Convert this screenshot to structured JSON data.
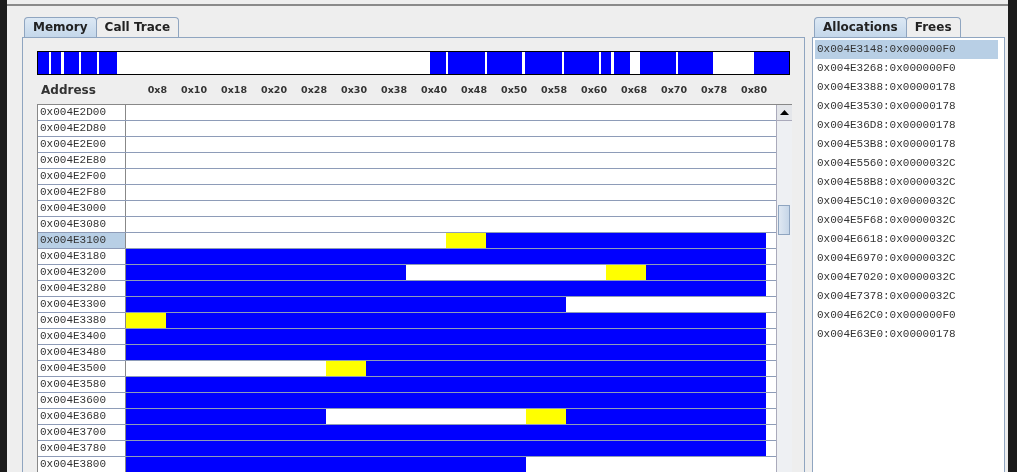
{
  "tabs": [
    {
      "label": "Memory",
      "selected": true
    },
    {
      "label": "Call Trace",
      "selected": false
    }
  ],
  "memory": {
    "address_header": "Address",
    "columns": [
      "0x8",
      "0x10",
      "0x18",
      "0x20",
      "0x28",
      "0x30",
      "0x38",
      "0x40",
      "0x48",
      "0x50",
      "0x58",
      "0x60",
      "0x68",
      "0x70",
      "0x78",
      "0x80"
    ],
    "rows": [
      {
        "address": "0x004E2D00",
        "selected": false,
        "cells": [
          {
            "kind": "free"
          },
          {
            "kind": "free"
          },
          {
            "kind": "free"
          },
          {
            "kind": "free"
          },
          {
            "kind": "free"
          },
          {
            "kind": "free"
          },
          {
            "kind": "free"
          },
          {
            "kind": "free"
          },
          {
            "kind": "free"
          },
          {
            "kind": "free"
          },
          {
            "kind": "free"
          },
          {
            "kind": "free"
          },
          {
            "kind": "free"
          },
          {
            "kind": "free"
          },
          {
            "kind": "free"
          },
          {
            "kind": "free"
          }
        ]
      },
      {
        "address": "0x004E2D80",
        "selected": false,
        "cells": [
          {
            "kind": "free"
          },
          {
            "kind": "free"
          },
          {
            "kind": "free"
          },
          {
            "kind": "free"
          },
          {
            "kind": "free"
          },
          {
            "kind": "free"
          },
          {
            "kind": "free"
          },
          {
            "kind": "free"
          },
          {
            "kind": "free"
          },
          {
            "kind": "free"
          },
          {
            "kind": "free"
          },
          {
            "kind": "free"
          },
          {
            "kind": "free"
          },
          {
            "kind": "free"
          },
          {
            "kind": "free"
          },
          {
            "kind": "free"
          }
        ]
      },
      {
        "address": "0x004E2E00",
        "selected": false,
        "cells": [
          {
            "kind": "free"
          },
          {
            "kind": "free"
          },
          {
            "kind": "free"
          },
          {
            "kind": "free"
          },
          {
            "kind": "free"
          },
          {
            "kind": "free"
          },
          {
            "kind": "free"
          },
          {
            "kind": "free"
          },
          {
            "kind": "free"
          },
          {
            "kind": "free"
          },
          {
            "kind": "free"
          },
          {
            "kind": "free"
          },
          {
            "kind": "free"
          },
          {
            "kind": "free"
          },
          {
            "kind": "free"
          },
          {
            "kind": "free"
          }
        ]
      },
      {
        "address": "0x004E2E80",
        "selected": false,
        "cells": [
          {
            "kind": "free"
          },
          {
            "kind": "free"
          },
          {
            "kind": "free"
          },
          {
            "kind": "free"
          },
          {
            "kind": "free"
          },
          {
            "kind": "free"
          },
          {
            "kind": "free"
          },
          {
            "kind": "free"
          },
          {
            "kind": "free"
          },
          {
            "kind": "free"
          },
          {
            "kind": "free"
          },
          {
            "kind": "free"
          },
          {
            "kind": "free"
          },
          {
            "kind": "free"
          },
          {
            "kind": "free"
          },
          {
            "kind": "free"
          }
        ]
      },
      {
        "address": "0x004E2F00",
        "selected": false,
        "cells": [
          {
            "kind": "free"
          },
          {
            "kind": "free"
          },
          {
            "kind": "free"
          },
          {
            "kind": "free"
          },
          {
            "kind": "free"
          },
          {
            "kind": "free"
          },
          {
            "kind": "free"
          },
          {
            "kind": "free"
          },
          {
            "kind": "free"
          },
          {
            "kind": "free"
          },
          {
            "kind": "free"
          },
          {
            "kind": "free"
          },
          {
            "kind": "free"
          },
          {
            "kind": "free"
          },
          {
            "kind": "free"
          },
          {
            "kind": "free"
          }
        ]
      },
      {
        "address": "0x004E2F80",
        "selected": false,
        "cells": [
          {
            "kind": "free"
          },
          {
            "kind": "free"
          },
          {
            "kind": "free"
          },
          {
            "kind": "free"
          },
          {
            "kind": "free"
          },
          {
            "kind": "free"
          },
          {
            "kind": "free"
          },
          {
            "kind": "free"
          },
          {
            "kind": "free"
          },
          {
            "kind": "free"
          },
          {
            "kind": "free"
          },
          {
            "kind": "free"
          },
          {
            "kind": "free"
          },
          {
            "kind": "free"
          },
          {
            "kind": "free"
          },
          {
            "kind": "free"
          }
        ]
      },
      {
        "address": "0x004E3000",
        "selected": false,
        "cells": [
          {
            "kind": "free"
          },
          {
            "kind": "free"
          },
          {
            "kind": "free"
          },
          {
            "kind": "free"
          },
          {
            "kind": "free"
          },
          {
            "kind": "free"
          },
          {
            "kind": "free"
          },
          {
            "kind": "free"
          },
          {
            "kind": "free"
          },
          {
            "kind": "free"
          },
          {
            "kind": "free"
          },
          {
            "kind": "free"
          },
          {
            "kind": "free"
          },
          {
            "kind": "free"
          },
          {
            "kind": "free"
          },
          {
            "kind": "free"
          }
        ]
      },
      {
        "address": "0x004E3080",
        "selected": false,
        "cells": [
          {
            "kind": "free"
          },
          {
            "kind": "free"
          },
          {
            "kind": "free"
          },
          {
            "kind": "free"
          },
          {
            "kind": "free"
          },
          {
            "kind": "free"
          },
          {
            "kind": "free"
          },
          {
            "kind": "free"
          },
          {
            "kind": "free"
          },
          {
            "kind": "free"
          },
          {
            "kind": "free"
          },
          {
            "kind": "free"
          },
          {
            "kind": "free"
          },
          {
            "kind": "free"
          },
          {
            "kind": "free"
          },
          {
            "kind": "free"
          }
        ]
      },
      {
        "address": "0x004E3100",
        "selected": true,
        "cells": [
          {
            "kind": "free"
          },
          {
            "kind": "free"
          },
          {
            "kind": "free"
          },
          {
            "kind": "free"
          },
          {
            "kind": "free"
          },
          {
            "kind": "free"
          },
          {
            "kind": "free"
          },
          {
            "kind": "free"
          },
          {
            "kind": "header"
          },
          {
            "kind": "used"
          },
          {
            "kind": "used"
          },
          {
            "kind": "used"
          },
          {
            "kind": "used"
          },
          {
            "kind": "used"
          },
          {
            "kind": "used"
          },
          {
            "kind": "used"
          }
        ]
      },
      {
        "address": "0x004E3180",
        "selected": false,
        "cells": [
          {
            "kind": "used"
          },
          {
            "kind": "used"
          },
          {
            "kind": "used"
          },
          {
            "kind": "used"
          },
          {
            "kind": "used"
          },
          {
            "kind": "used"
          },
          {
            "kind": "used"
          },
          {
            "kind": "used"
          },
          {
            "kind": "used"
          },
          {
            "kind": "used"
          },
          {
            "kind": "used"
          },
          {
            "kind": "used"
          },
          {
            "kind": "used"
          },
          {
            "kind": "used"
          },
          {
            "kind": "used"
          },
          {
            "kind": "used"
          }
        ]
      },
      {
        "address": "0x004E3200",
        "selected": false,
        "cells": [
          {
            "kind": "used"
          },
          {
            "kind": "used"
          },
          {
            "kind": "used"
          },
          {
            "kind": "used"
          },
          {
            "kind": "used"
          },
          {
            "kind": "used"
          },
          {
            "kind": "used"
          },
          {
            "kind": "free"
          },
          {
            "kind": "free"
          },
          {
            "kind": "free"
          },
          {
            "kind": "free"
          },
          {
            "kind": "free"
          },
          {
            "kind": "header"
          },
          {
            "kind": "used"
          },
          {
            "kind": "used"
          },
          {
            "kind": "used"
          }
        ]
      },
      {
        "address": "0x004E3280",
        "selected": false,
        "cells": [
          {
            "kind": "used"
          },
          {
            "kind": "used"
          },
          {
            "kind": "used"
          },
          {
            "kind": "used"
          },
          {
            "kind": "used"
          },
          {
            "kind": "used"
          },
          {
            "kind": "used"
          },
          {
            "kind": "used"
          },
          {
            "kind": "used"
          },
          {
            "kind": "used"
          },
          {
            "kind": "used"
          },
          {
            "kind": "used"
          },
          {
            "kind": "used"
          },
          {
            "kind": "used"
          },
          {
            "kind": "used"
          },
          {
            "kind": "used"
          }
        ]
      },
      {
        "address": "0x004E3300",
        "selected": false,
        "cells": [
          {
            "kind": "used"
          },
          {
            "kind": "used"
          },
          {
            "kind": "used"
          },
          {
            "kind": "used"
          },
          {
            "kind": "used"
          },
          {
            "kind": "used"
          },
          {
            "kind": "used"
          },
          {
            "kind": "used"
          },
          {
            "kind": "used"
          },
          {
            "kind": "used"
          },
          {
            "kind": "used"
          },
          {
            "kind": "free"
          },
          {
            "kind": "free"
          },
          {
            "kind": "free"
          },
          {
            "kind": "free"
          },
          {
            "kind": "free"
          }
        ]
      },
      {
        "address": "0x004E3380",
        "selected": false,
        "cells": [
          {
            "kind": "header"
          },
          {
            "kind": "used"
          },
          {
            "kind": "used"
          },
          {
            "kind": "used"
          },
          {
            "kind": "used"
          },
          {
            "kind": "used"
          },
          {
            "kind": "used"
          },
          {
            "kind": "used"
          },
          {
            "kind": "used"
          },
          {
            "kind": "used"
          },
          {
            "kind": "used"
          },
          {
            "kind": "used"
          },
          {
            "kind": "used"
          },
          {
            "kind": "used"
          },
          {
            "kind": "used"
          },
          {
            "kind": "used"
          }
        ]
      },
      {
        "address": "0x004E3400",
        "selected": false,
        "cells": [
          {
            "kind": "used"
          },
          {
            "kind": "used"
          },
          {
            "kind": "used"
          },
          {
            "kind": "used"
          },
          {
            "kind": "used"
          },
          {
            "kind": "used"
          },
          {
            "kind": "used"
          },
          {
            "kind": "used"
          },
          {
            "kind": "used"
          },
          {
            "kind": "used"
          },
          {
            "kind": "used"
          },
          {
            "kind": "used"
          },
          {
            "kind": "used"
          },
          {
            "kind": "used"
          },
          {
            "kind": "used"
          },
          {
            "kind": "used"
          }
        ]
      },
      {
        "address": "0x004E3480",
        "selected": false,
        "cells": [
          {
            "kind": "used"
          },
          {
            "kind": "used"
          },
          {
            "kind": "used"
          },
          {
            "kind": "used"
          },
          {
            "kind": "used"
          },
          {
            "kind": "used"
          },
          {
            "kind": "used"
          },
          {
            "kind": "used"
          },
          {
            "kind": "used"
          },
          {
            "kind": "used"
          },
          {
            "kind": "used"
          },
          {
            "kind": "used"
          },
          {
            "kind": "used"
          },
          {
            "kind": "used"
          },
          {
            "kind": "used"
          },
          {
            "kind": "used"
          }
        ]
      },
      {
        "address": "0x004E3500",
        "selected": false,
        "cells": [
          {
            "kind": "free"
          },
          {
            "kind": "free"
          },
          {
            "kind": "free"
          },
          {
            "kind": "free"
          },
          {
            "kind": "free"
          },
          {
            "kind": "header"
          },
          {
            "kind": "used"
          },
          {
            "kind": "used"
          },
          {
            "kind": "used"
          },
          {
            "kind": "used"
          },
          {
            "kind": "used"
          },
          {
            "kind": "used"
          },
          {
            "kind": "used"
          },
          {
            "kind": "used"
          },
          {
            "kind": "used"
          },
          {
            "kind": "used"
          }
        ]
      },
      {
        "address": "0x004E3580",
        "selected": false,
        "cells": [
          {
            "kind": "used"
          },
          {
            "kind": "used"
          },
          {
            "kind": "used"
          },
          {
            "kind": "used"
          },
          {
            "kind": "used"
          },
          {
            "kind": "used"
          },
          {
            "kind": "used"
          },
          {
            "kind": "used"
          },
          {
            "kind": "used"
          },
          {
            "kind": "used"
          },
          {
            "kind": "used"
          },
          {
            "kind": "used"
          },
          {
            "kind": "used"
          },
          {
            "kind": "used"
          },
          {
            "kind": "used"
          },
          {
            "kind": "used"
          }
        ]
      },
      {
        "address": "0x004E3600",
        "selected": false,
        "cells": [
          {
            "kind": "used"
          },
          {
            "kind": "used"
          },
          {
            "kind": "used"
          },
          {
            "kind": "used"
          },
          {
            "kind": "used"
          },
          {
            "kind": "used"
          },
          {
            "kind": "used"
          },
          {
            "kind": "used"
          },
          {
            "kind": "used"
          },
          {
            "kind": "used"
          },
          {
            "kind": "used"
          },
          {
            "kind": "used"
          },
          {
            "kind": "used"
          },
          {
            "kind": "used"
          },
          {
            "kind": "used"
          },
          {
            "kind": "used"
          }
        ]
      },
      {
        "address": "0x004E3680",
        "selected": false,
        "cells": [
          {
            "kind": "used"
          },
          {
            "kind": "used"
          },
          {
            "kind": "used"
          },
          {
            "kind": "used"
          },
          {
            "kind": "used"
          },
          {
            "kind": "free"
          },
          {
            "kind": "free"
          },
          {
            "kind": "free"
          },
          {
            "kind": "free"
          },
          {
            "kind": "free"
          },
          {
            "kind": "header"
          },
          {
            "kind": "used"
          },
          {
            "kind": "used"
          },
          {
            "kind": "used"
          },
          {
            "kind": "used"
          },
          {
            "kind": "used"
          }
        ]
      },
      {
        "address": "0x004E3700",
        "selected": false,
        "cells": [
          {
            "kind": "used"
          },
          {
            "kind": "used"
          },
          {
            "kind": "used"
          },
          {
            "kind": "used"
          },
          {
            "kind": "used"
          },
          {
            "kind": "used"
          },
          {
            "kind": "used"
          },
          {
            "kind": "used"
          },
          {
            "kind": "used"
          },
          {
            "kind": "used"
          },
          {
            "kind": "used"
          },
          {
            "kind": "used"
          },
          {
            "kind": "used"
          },
          {
            "kind": "used"
          },
          {
            "kind": "used"
          },
          {
            "kind": "used"
          }
        ]
      },
      {
        "address": "0x004E3780",
        "selected": false,
        "cells": [
          {
            "kind": "used"
          },
          {
            "kind": "used"
          },
          {
            "kind": "used"
          },
          {
            "kind": "used"
          },
          {
            "kind": "used"
          },
          {
            "kind": "used"
          },
          {
            "kind": "used"
          },
          {
            "kind": "used"
          },
          {
            "kind": "used"
          },
          {
            "kind": "used"
          },
          {
            "kind": "used"
          },
          {
            "kind": "used"
          },
          {
            "kind": "used"
          },
          {
            "kind": "used"
          },
          {
            "kind": "used"
          },
          {
            "kind": "used"
          }
        ]
      },
      {
        "address": "0x004E3800",
        "selected": false,
        "cells": [
          {
            "kind": "used"
          },
          {
            "kind": "used"
          },
          {
            "kind": "used"
          },
          {
            "kind": "used"
          },
          {
            "kind": "used"
          },
          {
            "kind": "used"
          },
          {
            "kind": "used"
          },
          {
            "kind": "used"
          },
          {
            "kind": "used"
          },
          {
            "kind": "used"
          },
          {
            "kind": "free"
          },
          {
            "kind": "free"
          },
          {
            "kind": "free"
          },
          {
            "kind": "free"
          },
          {
            "kind": "free"
          },
          {
            "kind": "free"
          }
        ]
      }
    ]
  },
  "side_tabs": [
    {
      "label": "Allocations",
      "selected": true
    },
    {
      "label": "Frees",
      "selected": false
    }
  ],
  "allocations": [
    {
      "text": "0x004E3148:0x000000F0",
      "selected": true
    },
    {
      "text": "0x004E3268:0x000000F0",
      "selected": false
    },
    {
      "text": "0x004E3388:0x00000178",
      "selected": false
    },
    {
      "text": "0x004E3530:0x00000178",
      "selected": false
    },
    {
      "text": "0x004E36D8:0x00000178",
      "selected": false
    },
    {
      "text": "0x004E53B8:0x00000178",
      "selected": false
    },
    {
      "text": "0x004E5560:0x0000032C",
      "selected": false
    },
    {
      "text": "0x004E58B8:0x0000032C",
      "selected": false
    },
    {
      "text": "0x004E5C10:0x0000032C",
      "selected": false
    },
    {
      "text": "0x004E5F68:0x0000032C",
      "selected": false
    },
    {
      "text": "0x004E6618:0x0000032C",
      "selected": false
    },
    {
      "text": "0x004E6970:0x0000032C",
      "selected": false
    },
    {
      "text": "0x004E7020:0x0000032C",
      "selected": false
    },
    {
      "text": "0x004E7378:0x0000032C",
      "selected": false
    },
    {
      "text": "0x004E62C0:0x000000F0",
      "selected": false
    },
    {
      "text": "0x004E63E0:0x00000178",
      "selected": false
    }
  ]
}
